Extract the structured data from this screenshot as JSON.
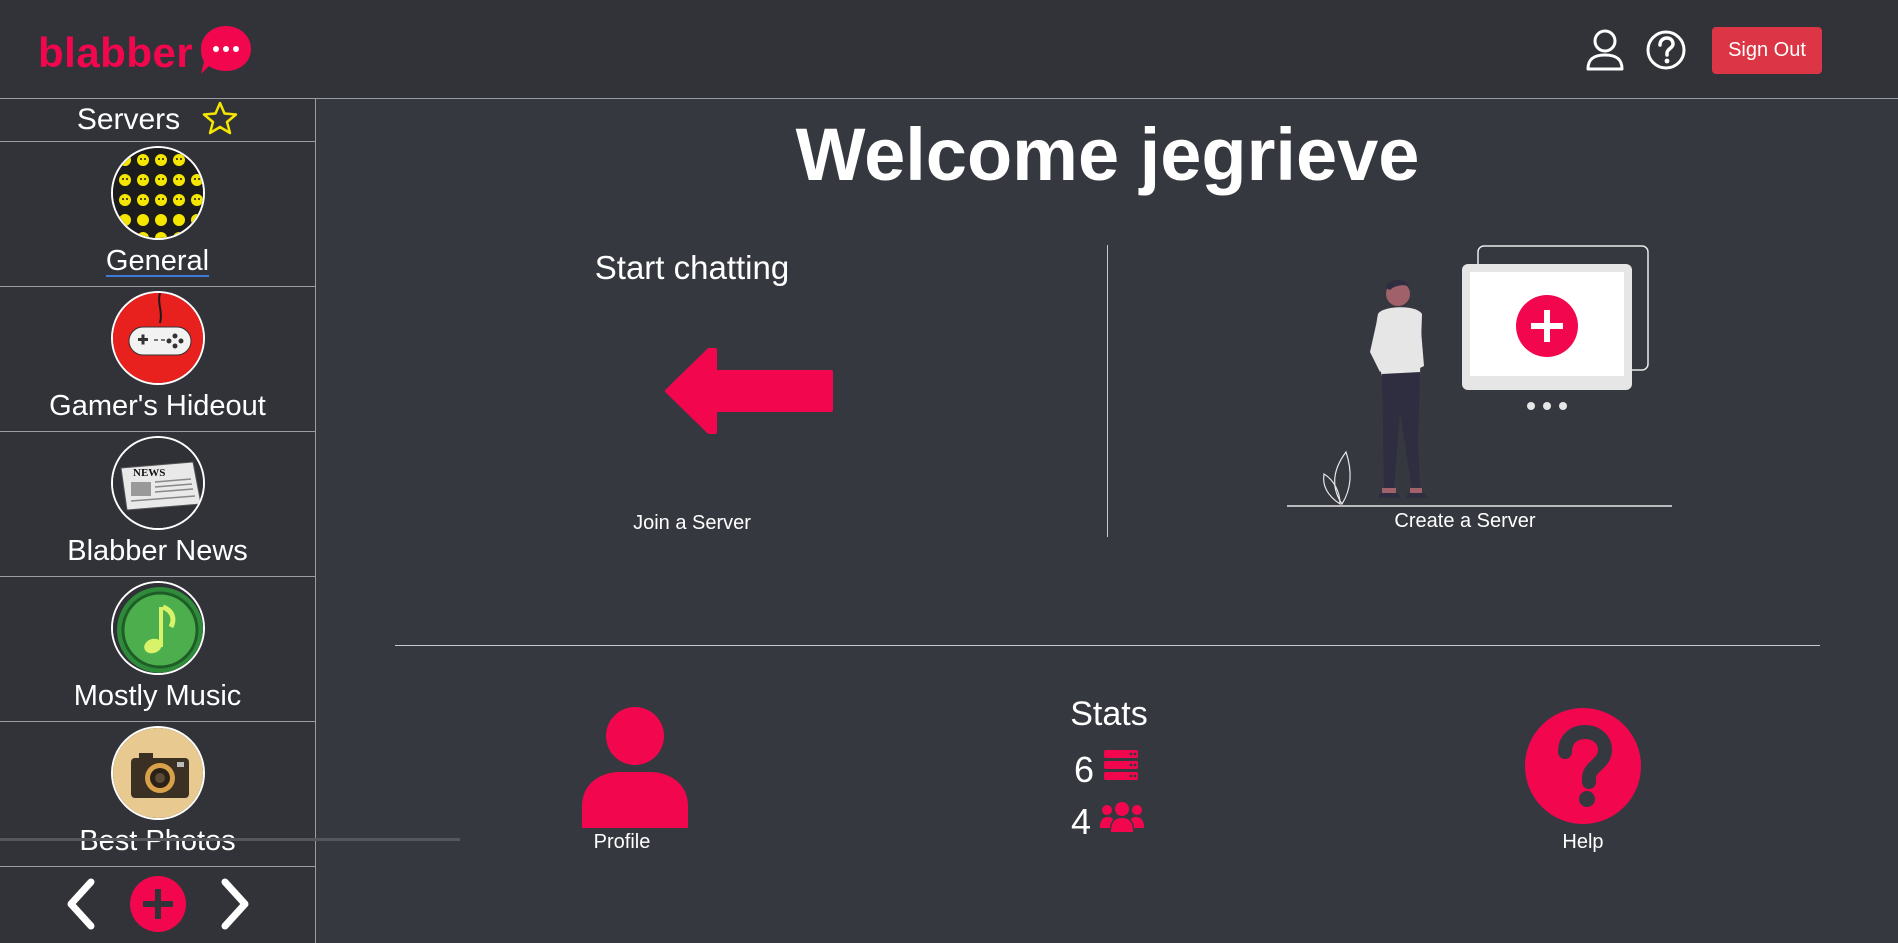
{
  "header": {
    "logo_text": "blabber",
    "icons": [
      "user-profile-icon",
      "help-circle-icon"
    ],
    "sign_out_label": "Sign Out",
    "colors": {
      "brand": "#f2074f",
      "danger": "#dc3545",
      "bar_bg": "#313338"
    }
  },
  "sidebar": {
    "title": "Servers",
    "title_icon": "star-outline-icon",
    "servers": [
      {
        "name": "General",
        "icon": "emoji-grid-avatar",
        "active": true
      },
      {
        "name": "Gamer's Hideout",
        "icon": "gamepad-avatar",
        "active": false
      },
      {
        "name": "Blabber News",
        "icon": "newspaper-avatar",
        "active": false
      },
      {
        "name": "Mostly Music",
        "icon": "music-note-avatar",
        "active": false
      },
      {
        "name": "Best Photos",
        "icon": "camera-avatar",
        "active": false
      }
    ],
    "footer_icons": [
      "chevron-left-icon",
      "add-server-icon",
      "chevron-right-icon"
    ]
  },
  "main": {
    "welcome": "Welcome jegrieve",
    "start_chatting": "Start chatting",
    "join_label": "Join a Server",
    "create_label": "Create a Server",
    "stats": {
      "title": "Stats",
      "servers_count": "6",
      "servers_icon": "server-stack-icon",
      "friends_count": "4",
      "friends_icon": "users-group-icon"
    },
    "profile_label": "Profile",
    "help_label": "Help"
  }
}
